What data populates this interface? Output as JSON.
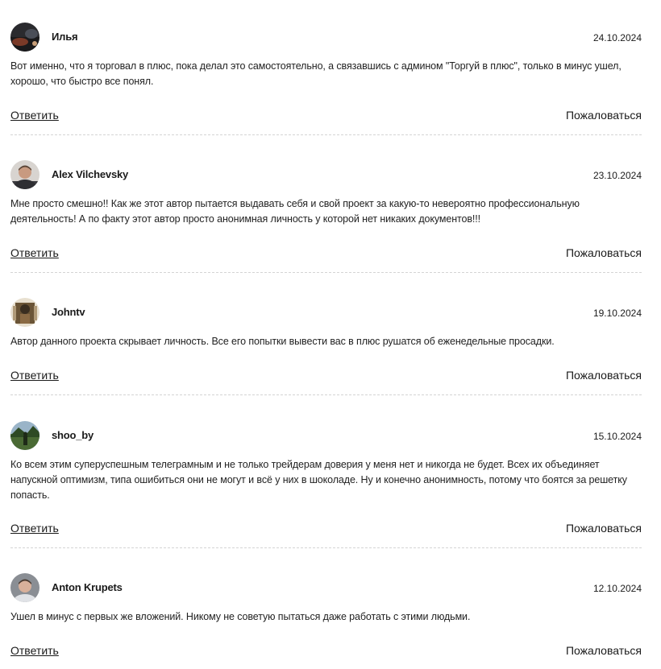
{
  "comments": [
    {
      "author": "Илья",
      "date": "24.10.2024",
      "text": "Вот именно, что я торговал в плюс, пока делал это самостоятельно, а связавшись с админом \"Торгуй в плюс\", только в минус ушел, хорошо, что быстро все понял.",
      "reply_label": "Ответить",
      "report_label": "Пожаловаться"
    },
    {
      "author": "Alex Vilchevsky",
      "date": "23.10.2024",
      "text": "Мне просто смешно!! Как же этот автор пытается выдавать себя и свой проект за какую-то невероятно профессиональную деятельность! А по факту этот автор просто анонимная личность у которой нет никаких документов!!!",
      "reply_label": "Ответить",
      "report_label": "Пожаловаться"
    },
    {
      "author": "Johntv",
      "date": "19.10.2024",
      "text": "Автор данного проекта скрывает личность. Все его попытки вывести вас в плюс рушатся об еженедельные просадки.",
      "reply_label": "Ответить",
      "report_label": "Пожаловаться"
    },
    {
      "author": "shoo_by",
      "date": "15.10.2024",
      "text": "Ко всем этим суперуспешным телеграмным и не только трейдерам доверия у меня нет и никогда не будет. Всех их объединяет напускной оптимизм, типа ошибиться они не могут и всё у них в шоколаде. Ну и конечно анонимность, потому что боятся за решетку попасть.",
      "reply_label": "Ответить",
      "report_label": "Пожаловаться"
    },
    {
      "author": "Anton Krupets",
      "date": "12.10.2024",
      "text": "Ушел в минус с первых же вложений. Никому не советую пытаться даже работать с этими людьми.",
      "reply_label": "Ответить",
      "report_label": "Пожаловаться"
    }
  ]
}
